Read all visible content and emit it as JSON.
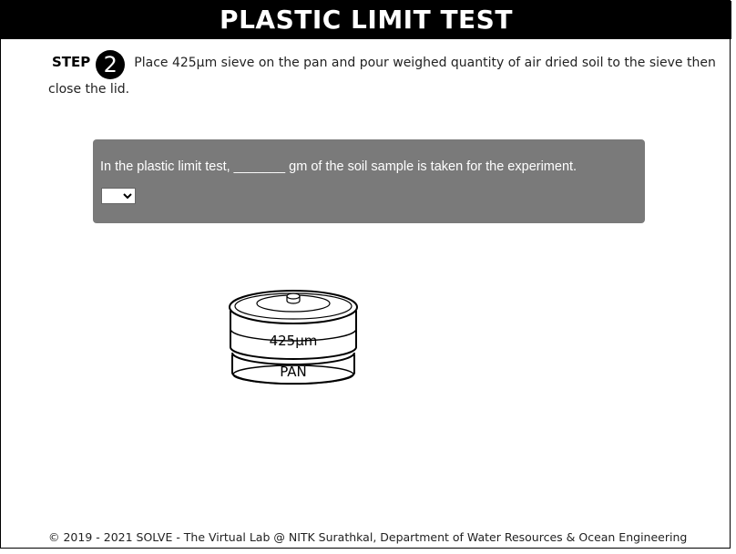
{
  "header": {
    "title": "PLASTIC LIMIT TEST"
  },
  "step": {
    "label": "STEP",
    "number": "2",
    "instruction": "Place 425μm sieve on the pan and pour weighed quantity of air dried soil to the sieve then close the lid."
  },
  "question": {
    "text": "In the plastic limit test, _______ gm of the soil sample is taken for the experiment.",
    "selected_value": ""
  },
  "diagram": {
    "sieve_label": "425μm",
    "pan_label": "PAN"
  },
  "footer": {
    "text": "© 2019 - 2021 SOLVE - The Virtual Lab @ NITK Surathkal, Department of Water Resources & Ocean Engineering"
  }
}
